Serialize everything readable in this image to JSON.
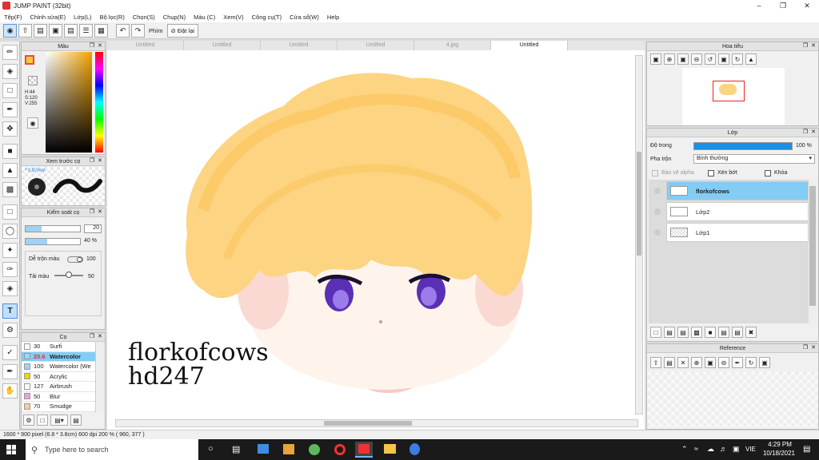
{
  "window": {
    "title": "JUMP PAINT (32bit)"
  },
  "menu": [
    "Tệp(F)",
    "Chỉnh sửa(E)",
    "Lớp(L)",
    "Bộ lọc(R)",
    "Chọn(S)",
    "Chụp(N)",
    "Màu (C)",
    "Xem(V)",
    "Công cụ(T)",
    "Cửa sổ(W)",
    "Help"
  ],
  "toolbar": {
    "label": "Phím",
    "button": "Đặt lại"
  },
  "tabs": [
    "Untitled",
    "Untitled",
    "Untitled",
    "Untitled",
    "4.jpg",
    "Untitled"
  ],
  "panels": {
    "color": "Màu",
    "preview": "Xem trước cọ",
    "control": "Kiểm soát cọ",
    "brush": "Cọ",
    "navigator": "Hoa tiêu",
    "layer": "Lớp",
    "reference": "Reference"
  },
  "color": {
    "hsv": "H:44\nS:120\nV:255",
    "current": "#fbc93f"
  },
  "preview": {
    "size": "* 0.87mm"
  },
  "control": {
    "size_value": "20",
    "opacity_value": "40 %",
    "blend_label": "Dễ trộn màu",
    "blend_value": "100",
    "load_label": "Tải màu",
    "load_value": "50",
    "size_fill": 0.3,
    "opacity_fill": 0.4
  },
  "brushes": [
    {
      "size": "30",
      "name": "Surfi",
      "swatch": "#ffffff"
    },
    {
      "size": "20.6",
      "name": "Watercolor",
      "swatch": "#9fd2f5",
      "selected": true
    },
    {
      "size": "100",
      "name": "Watercolor (We",
      "swatch": "#9fd2f5"
    },
    {
      "size": "50",
      "name": "Acrylic",
      "swatch": "#e8d800"
    },
    {
      "size": "127",
      "name": "Airbrush",
      "swatch": "#ffffff"
    },
    {
      "size": "50",
      "name": "Blur",
      "swatch": "#f0a0e0"
    },
    {
      "size": "70",
      "name": "Smudge",
      "swatch": "#ffcc99"
    }
  ],
  "layer": {
    "opacity_label": "Độ trong",
    "opacity_value": "100 %",
    "blend_label": "Pha trộn",
    "blend_value": "Bình thường",
    "protect_alpha": "Bảo vệ alpha",
    "clipping": "Xén bớt",
    "lock": "Khóa",
    "layers": [
      "florkofcows",
      "Lớp2",
      "Lớp1"
    ]
  },
  "canvas": {
    "text_line1": "florkofcows",
    "text_line2": "hd247"
  },
  "status": "1600 * 900 pixel   (6.8 * 3.8cm)   600 dpi   200 %   ( 960, 377 )",
  "taskbar": {
    "search": "Type here to search",
    "lang": "VIE",
    "time": "4:29 PM",
    "date": "10/18/2021"
  }
}
